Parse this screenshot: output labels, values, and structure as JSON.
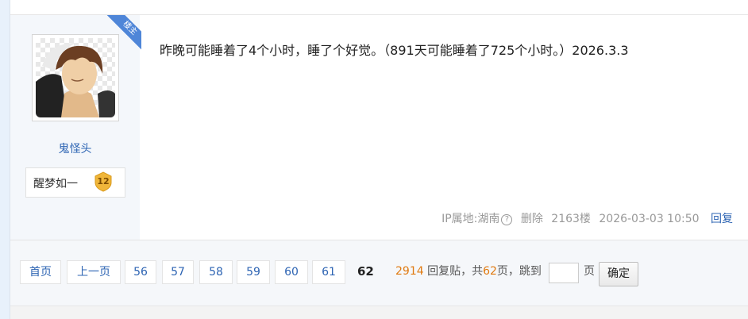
{
  "post": {
    "badge": "楼主",
    "author": {
      "name": "鬼怪头",
      "level_name": "醒梦如一",
      "level": "12"
    },
    "content": "昨晚可能睡着了4个小时，睡了个好觉。（891天可能睡着了725个小时。）2026.3.3",
    "meta": {
      "ip_location": "IP属地:湖南",
      "help_icon": "question-circle-icon",
      "delete": "删除",
      "floor": "2163楼",
      "time": "2026-03-03 10:50",
      "reply": "回复"
    }
  },
  "pagination": {
    "first": "首页",
    "prev": "上一页",
    "pages": [
      "56",
      "57",
      "58",
      "59",
      "60",
      "61"
    ],
    "current": "62",
    "total_replies": "2914",
    "replies_label": "回复贴，共",
    "total_pages": "62",
    "pages_unit": "页，跳到",
    "jump_unit": "页",
    "jump_placeholder": "",
    "confirm": "确定"
  },
  "colors": {
    "link": "#2d64b3",
    "accent": "#e07a10",
    "ribbon": "#4f86d8",
    "badge_gold": "#f0b63a"
  }
}
